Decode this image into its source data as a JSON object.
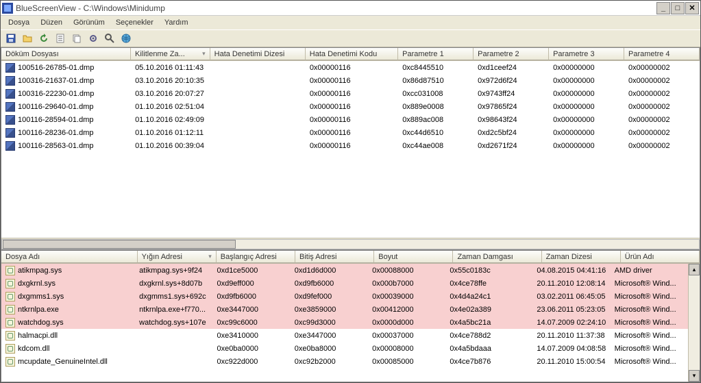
{
  "titlebar": {
    "text": "BlueScreenView  -  C:\\Windows\\Minidump"
  },
  "menu": {
    "items": [
      "Dosya",
      "Düzen",
      "Görünüm",
      "Seçenekler",
      "Yardım"
    ]
  },
  "toolbar": {
    "icons": [
      "save-icon",
      "folder-icon",
      "refresh-icon",
      "props-icon",
      "copy-icon",
      "settings-icon",
      "find-icon",
      "web-icon"
    ]
  },
  "top": {
    "headers": [
      "Döküm Dosyası",
      "Kilitlenme Za...",
      "Hata Denetimi Dizesi",
      "Hata Denetimi Kodu",
      "Parametre 1",
      "Parametre 2",
      "Parametre 3",
      "Parametre 4"
    ],
    "sort_col": 1,
    "sort_dir": "desc",
    "rows": [
      {
        "file": "100516-26785-01.dmp",
        "time": "05.10.2016 01:11:43",
        "str": "",
        "code": "0x00000116",
        "p1": "0xc8445510",
        "p2": "0xd1ceef24",
        "p3": "0x00000000",
        "p4": "0x00000002"
      },
      {
        "file": "100316-21637-01.dmp",
        "time": "03.10.2016 20:10:35",
        "str": "",
        "code": "0x00000116",
        "p1": "0x86d87510",
        "p2": "0x972d6f24",
        "p3": "0x00000000",
        "p4": "0x00000002"
      },
      {
        "file": "100316-22230-01.dmp",
        "time": "03.10.2016 20:07:27",
        "str": "",
        "code": "0x00000116",
        "p1": "0xcc031008",
        "p2": "0x9743ff24",
        "p3": "0x00000000",
        "p4": "0x00000002"
      },
      {
        "file": "100116-29640-01.dmp",
        "time": "01.10.2016 02:51:04",
        "str": "",
        "code": "0x00000116",
        "p1": "0x889e0008",
        "p2": "0x97865f24",
        "p3": "0x00000000",
        "p4": "0x00000002"
      },
      {
        "file": "100116-28594-01.dmp",
        "time": "01.10.2016 02:49:09",
        "str": "",
        "code": "0x00000116",
        "p1": "0x889ac008",
        "p2": "0x98643f24",
        "p3": "0x00000000",
        "p4": "0x00000002"
      },
      {
        "file": "100116-28236-01.dmp",
        "time": "01.10.2016 01:12:11",
        "str": "",
        "code": "0x00000116",
        "p1": "0xc44d6510",
        "p2": "0xd2c5bf24",
        "p3": "0x00000000",
        "p4": "0x00000002"
      },
      {
        "file": "100116-28563-01.dmp",
        "time": "01.10.2016 00:39:04",
        "str": "",
        "code": "0x00000116",
        "p1": "0xc44ae008",
        "p2": "0xd2671f24",
        "p3": "0x00000000",
        "p4": "0x00000002"
      }
    ]
  },
  "bottom": {
    "headers": [
      "Dosya Adı",
      "Yığın Adresi",
      "Başlangıç Adresi",
      "Bitiş Adresi",
      "Boyut",
      "Zaman Damgası",
      "Zaman Dizesi",
      "Ürün Adı"
    ],
    "sort_col": 1,
    "sort_dir": "desc",
    "rows": [
      {
        "pink": true,
        "file": "atikmpag.sys",
        "stack": "atikmpag.sys+9f24",
        "start": "0xd1ce5000",
        "end": "0xd1d6d000",
        "size": "0x00088000",
        "stamp": "0x55c0183c",
        "tstr": "04.08.2015 04:41:16",
        "prod": "AMD driver"
      },
      {
        "pink": true,
        "file": "dxgkrnl.sys",
        "stack": "dxgkrnl.sys+8d07b",
        "start": "0xd9eff000",
        "end": "0xd9fb6000",
        "size": "0x000b7000",
        "stamp": "0x4ce78ffe",
        "tstr": "20.11.2010 12:08:14",
        "prod": "Microsoft® Wind..."
      },
      {
        "pink": true,
        "file": "dxgmms1.sys",
        "stack": "dxgmms1.sys+692c",
        "start": "0xd9fb6000",
        "end": "0xd9fef000",
        "size": "0x00039000",
        "stamp": "0x4d4a24c1",
        "tstr": "03.02.2011 06:45:05",
        "prod": "Microsoft® Wind..."
      },
      {
        "pink": true,
        "file": "ntkrnlpa.exe",
        "stack": "ntkrnlpa.exe+f770...",
        "start": "0xe3447000",
        "end": "0xe3859000",
        "size": "0x00412000",
        "stamp": "0x4e02a389",
        "tstr": "23.06.2011 05:23:05",
        "prod": "Microsoft® Wind..."
      },
      {
        "pink": true,
        "file": "watchdog.sys",
        "stack": "watchdog.sys+107e",
        "start": "0xc99c6000",
        "end": "0xc99d3000",
        "size": "0x0000d000",
        "stamp": "0x4a5bc21a",
        "tstr": "14.07.2009 02:24:10",
        "prod": "Microsoft® Wind..."
      },
      {
        "pink": false,
        "file": "halmacpi.dll",
        "stack": "",
        "start": "0xe3410000",
        "end": "0xe3447000",
        "size": "0x00037000",
        "stamp": "0x4ce788d2",
        "tstr": "20.11.2010 11:37:38",
        "prod": "Microsoft® Wind..."
      },
      {
        "pink": false,
        "file": "kdcom.dll",
        "stack": "",
        "start": "0xe0ba0000",
        "end": "0xe0ba8000",
        "size": "0x00008000",
        "stamp": "0x4a5bdaaa",
        "tstr": "14.07.2009 04:08:58",
        "prod": "Microsoft® Wind..."
      },
      {
        "pink": false,
        "file": "mcupdate_GenuineIntel.dll",
        "stack": "",
        "start": "0xc922d000",
        "end": "0xc92b2000",
        "size": "0x00085000",
        "stamp": "0x4ce7b876",
        "tstr": "20.11.2010 15:00:54",
        "prod": "Microsoft® Wind..."
      }
    ]
  }
}
